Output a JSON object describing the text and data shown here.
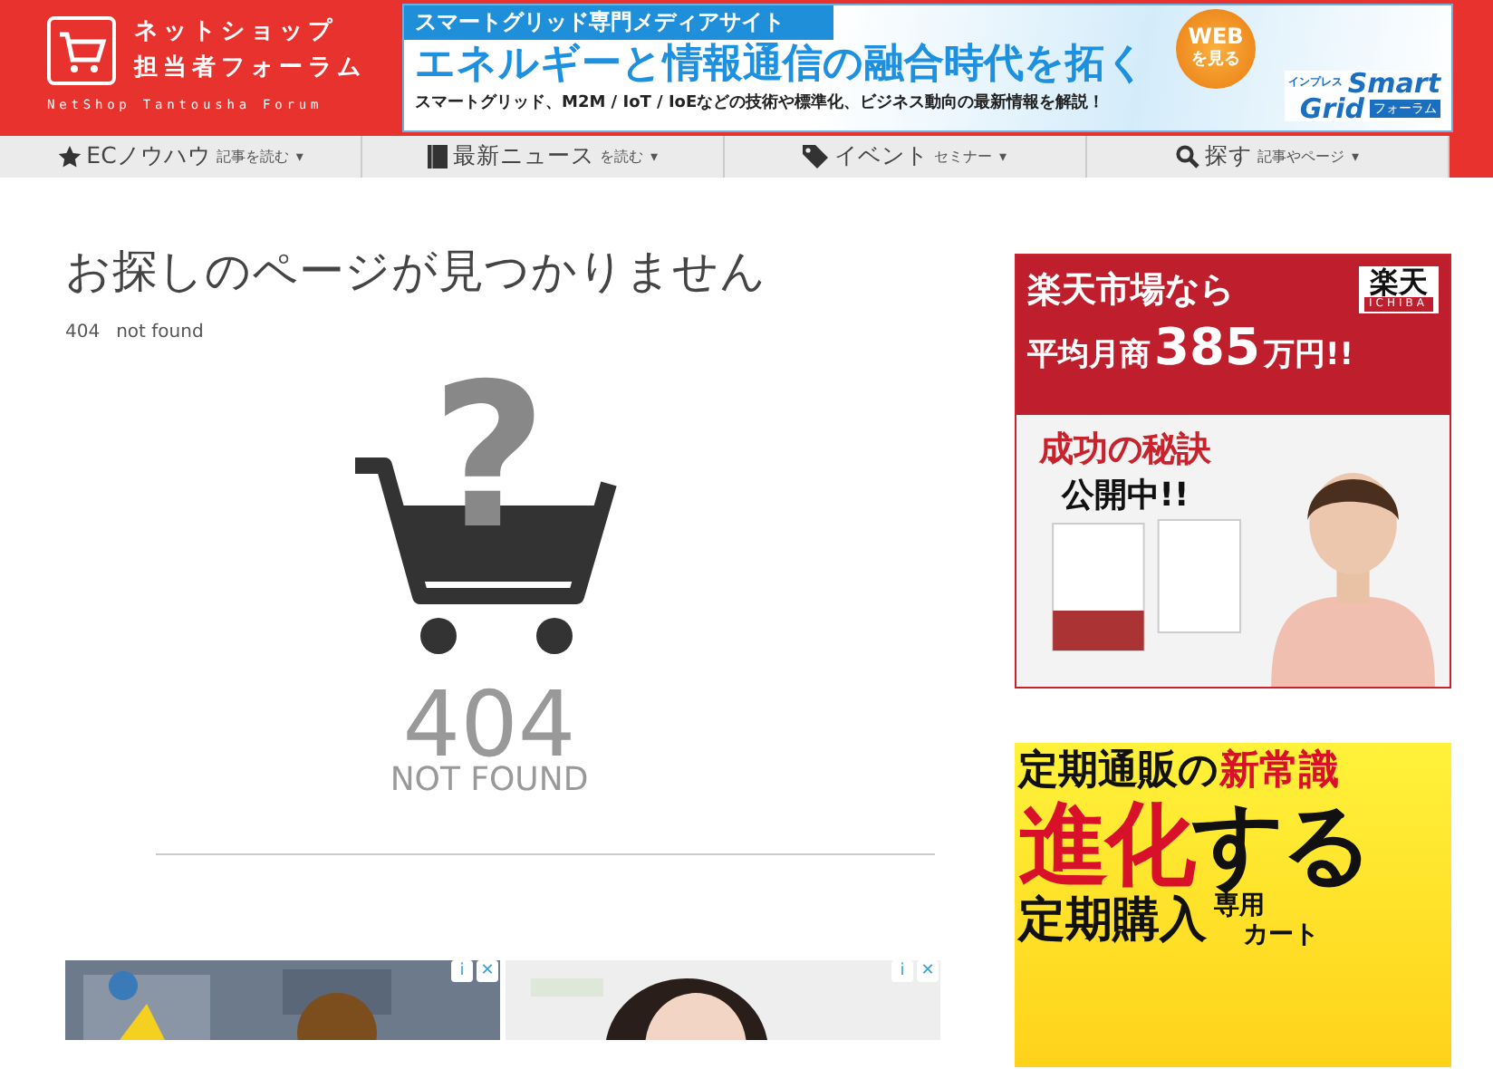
{
  "header": {
    "logo": {
      "lines": [
        "ネットショップ",
        "担当者フォーラム"
      ],
      "subtitle": "NetShop Tantousha Forum"
    },
    "banner": {
      "top": "スマートグリッド専門メディアサイト",
      "headline": "エネルギーと情報通信の融合時代を拓く",
      "sub": "スマートグリッド、M2M / IoT / IoEなどの技術や標準化、ビジネス動向の最新情報を解説！",
      "badge": [
        "WEB",
        "を見る"
      ],
      "brand_small": "インプレス",
      "brand": [
        "Smart",
        "Grid"
      ],
      "brand_tag": "フォーラム"
    }
  },
  "nav": [
    {
      "label": "ECノウハウ",
      "sub": "記事を読む",
      "caret": "▾"
    },
    {
      "label": "最新ニュース",
      "sub": "を読む",
      "caret": "▾"
    },
    {
      "label": "イベント",
      "sub": "セミナー",
      "caret": "▾"
    },
    {
      "label": "探す",
      "sub": "記事やページ",
      "caret": "▾"
    }
  ],
  "page": {
    "title": "お探しのページが見つかりません",
    "code": "404",
    "note": "not found",
    "graphic": {
      "mark": "?",
      "code": "404",
      "label": "NOT FOUND"
    }
  },
  "bottom_ads": [
    {
      "kind": "picture",
      "info": "i",
      "close": "✕"
    },
    {
      "kind": "picture",
      "info": "i",
      "close": "✕"
    }
  ],
  "sidebar_ads": [
    {
      "kind": "rakuten",
      "line1": "楽天市場なら",
      "line2a": "平均月商",
      "line2b": "385",
      "line2c": "万円!!",
      "logo": "楽天",
      "logo_sub": "ICHIBA",
      "pitch1": "成功の秘訣",
      "pitch2": "公開中!!"
    },
    {
      "kind": "cart",
      "l1a": "定期通販の",
      "l1b": "新常識",
      "l2a": "進化",
      "l2b": "する",
      "l3a": "定期購入",
      "l3b": "専用",
      "l3c": "カート"
    }
  ]
}
